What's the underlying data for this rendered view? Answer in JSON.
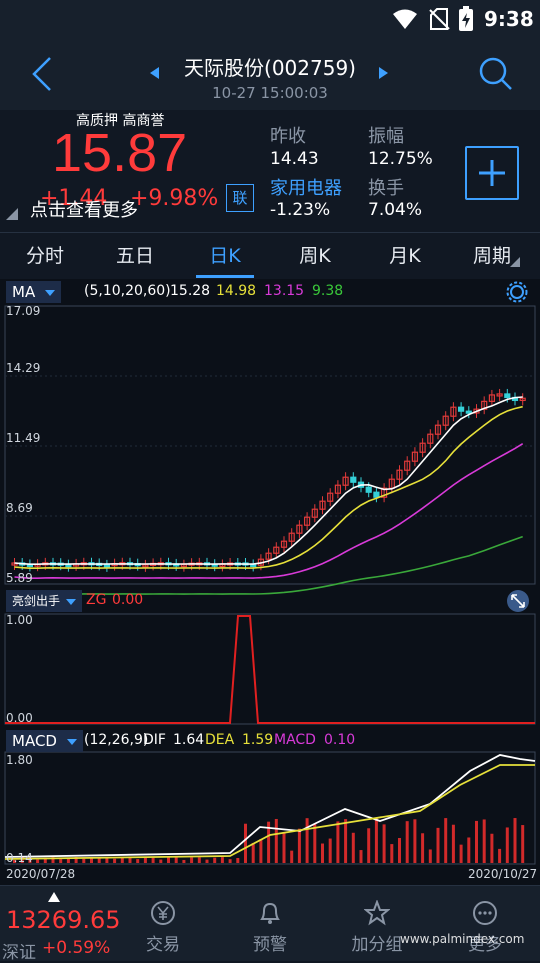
{
  "status": {
    "time": "9:38"
  },
  "header": {
    "title": "天际股份(002759)",
    "datetime": "10-27 15:00:03"
  },
  "quote": {
    "tags": "高质押 高商誉",
    "price": "15.87",
    "change": "+1.44",
    "change_pct": "+9.98%",
    "hint": "点击查看更多",
    "lian_badge": "联",
    "prev_close_label": "昨收",
    "prev_close_value": "14.43",
    "amplitude_label": "振幅",
    "amplitude_value": "12.75%",
    "sector_label": "家用电器",
    "sector_value": "-1.23%",
    "turnover_label": "换手",
    "turnover_value": "7.04%"
  },
  "tabs": [
    "分时",
    "五日",
    "日K",
    "周K",
    "月K",
    "周期"
  ],
  "active_tab": 2,
  "ma_panel": {
    "indicator": "MA",
    "params": "(5,10,20,60)",
    "ma5": "15.28",
    "ma10": "14.98",
    "ma20": "13.15",
    "ma60": "9.38",
    "y_labels": [
      "17.09",
      "14.29",
      "11.49",
      "8.69",
      "5.89"
    ],
    "colors": {
      "ma5": "#ffffff",
      "ma10": "#e6e03a",
      "ma20": "#d83ad8",
      "ma60": "#3aa83a",
      "up": "#e23a3a",
      "down": "#35d0d8"
    }
  },
  "zg_panel": {
    "indicator": "亮剑出手",
    "label": "ZG",
    "value": "0.00",
    "y_labels": [
      "1.00",
      "0.00"
    ]
  },
  "macd_panel": {
    "indicator": "MACD",
    "params": "(12,26,9)",
    "dif_label": "DIF",
    "dif": "1.64",
    "dea_label": "DEA",
    "dea": "1.59",
    "macd_label": "MACD",
    "macd": "0.10",
    "y_labels": [
      "1.80",
      "0.14"
    ],
    "start_date": "2020/07/28",
    "end_date": "2020/10/27"
  },
  "bottom_nav": {
    "index_value": "13269.65",
    "index_name": "深证",
    "index_change": "+0.59%",
    "items": [
      "交易",
      "预警",
      "加分组",
      "更多"
    ]
  },
  "watermark": "www.palmindex.com"
}
